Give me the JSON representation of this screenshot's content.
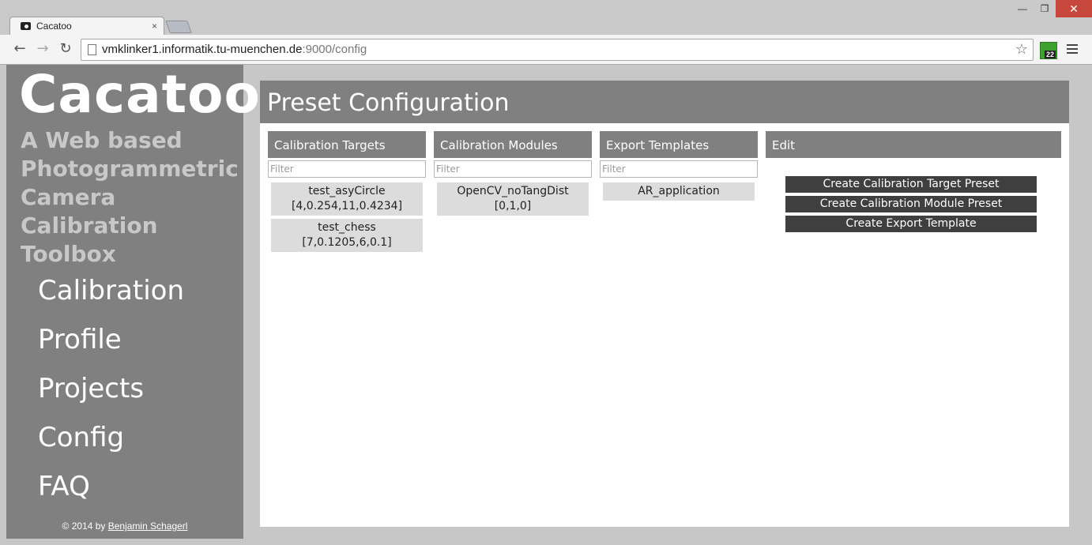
{
  "browser": {
    "tab_title": "Cacatoo",
    "tab_close": "×",
    "url_host": "vmklinker1.informatik.tu-muenchen.de",
    "url_path": ":9000/config",
    "extension_badge": "22",
    "window_controls": {
      "minimize": "—",
      "maximize": "❐",
      "close": "✕"
    }
  },
  "sidebar": {
    "brand": "Cacatoo",
    "tagline": "A Web based Photogrammetric Camera Calibration Toolbox",
    "nav": [
      {
        "label": "Calibration"
      },
      {
        "label": "Profile"
      },
      {
        "label": "Projects"
      },
      {
        "label": "Config"
      },
      {
        "label": "FAQ"
      }
    ],
    "footer_prefix": "© 2014 by ",
    "footer_author": "Benjamin Schagerl"
  },
  "main": {
    "title": "Preset Configuration",
    "columns": [
      {
        "header": "Calibration Targets",
        "filter_placeholder": "Filter",
        "items": [
          {
            "name": "test_asyCircle",
            "params": "[4,0.254,11,0.4234]"
          },
          {
            "name": "test_chess",
            "params": "[7,0.1205,6,0.1]"
          }
        ]
      },
      {
        "header": "Calibration Modules",
        "filter_placeholder": "Filter",
        "items": [
          {
            "name": "OpenCV_noTangDist",
            "params": "[0,1,0]"
          }
        ]
      },
      {
        "header": "Export Templates",
        "filter_placeholder": "Filter",
        "items": [
          {
            "name": "AR_application"
          }
        ]
      }
    ],
    "edit": {
      "header": "Edit",
      "buttons": [
        {
          "label": "Create Calibration Target Preset"
        },
        {
          "label": "Create Calibration Module Preset"
        },
        {
          "label": "Create Export Template"
        }
      ]
    }
  },
  "colors": {
    "sidebar_bg": "#808080",
    "header_bg": "#808080",
    "item_bg": "#dcdcdc",
    "button_bg": "#3f3f3f",
    "tagline": "#c8c8c8"
  }
}
